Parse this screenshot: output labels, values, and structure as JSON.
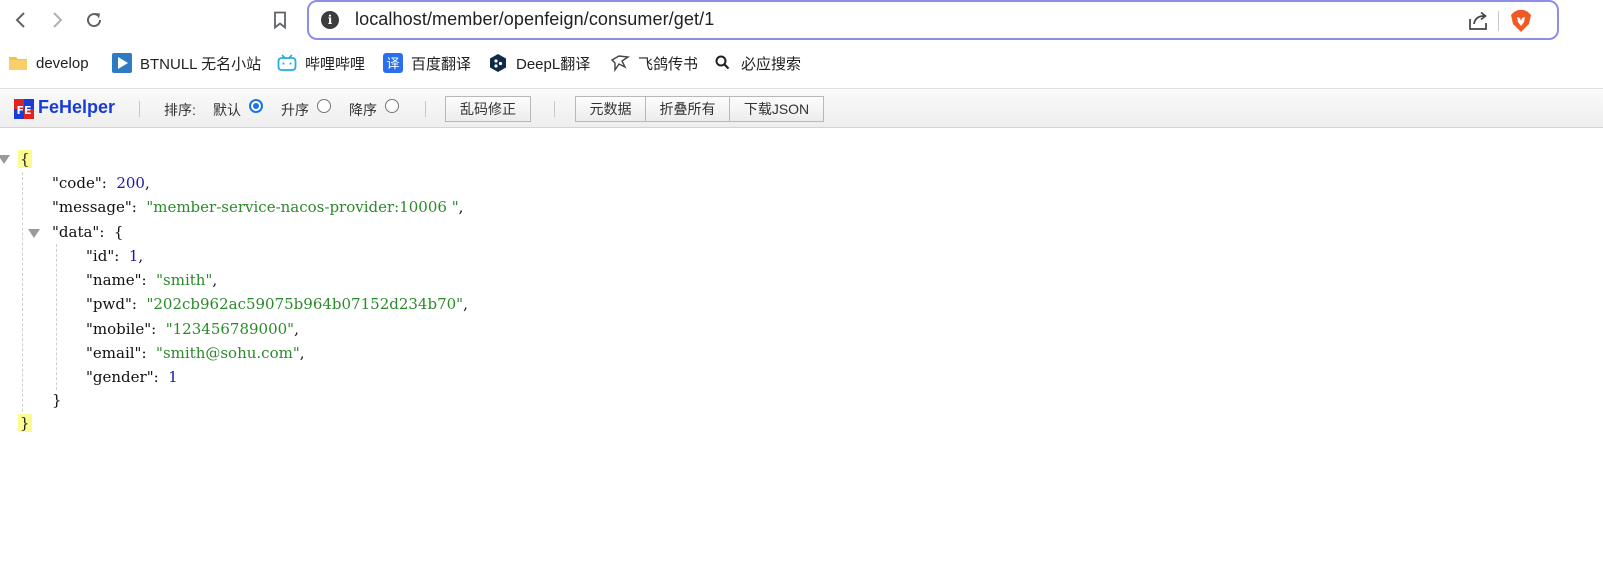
{
  "browser": {
    "url": "localhost/member/openfeign/consumer/get/1",
    "icons": {
      "back": "back-arrow-icon",
      "forward": "forward-arrow-icon",
      "reload": "reload-icon",
      "bookmark": "bookmark-icon",
      "info": "site-info-icon",
      "share": "share-icon",
      "brave": "brave-shield-icon"
    },
    "accent_color": "#8e8ee6"
  },
  "bookmarks": [
    {
      "label": "develop",
      "icon": "folder-icon"
    },
    {
      "label": "BTNULL 无名小站",
      "icon": "play-icon"
    },
    {
      "label": "哔哩哔哩",
      "icon": "bilibili-icon"
    },
    {
      "label": "百度翻译",
      "icon": "translate-icon"
    },
    {
      "label": "DeepL翻译",
      "icon": "deepl-icon"
    },
    {
      "label": "飞鸽传书",
      "icon": "pigeon-icon"
    },
    {
      "label": "必应搜索",
      "icon": "search-icon"
    }
  ],
  "fehelper": {
    "title": "FeHelper",
    "sort_label": "排序:",
    "sort_options": [
      {
        "label": "默认",
        "checked": true
      },
      {
        "label": "升序",
        "checked": false
      },
      {
        "label": "降序",
        "checked": false
      }
    ],
    "fix_encoding": "乱码修正",
    "metadata": "元数据",
    "collapse_all": "折叠所有",
    "download_json": "下载JSON",
    "brand_color": "#1a3cd6"
  },
  "json": {
    "code": {
      "key": "code",
      "value": "200"
    },
    "message": {
      "key": "message",
      "value": "member-service-nacos-provider:10006 "
    },
    "data_key": "data",
    "data": [
      {
        "key": "id",
        "value": "1",
        "type": "number"
      },
      {
        "key": "name",
        "value": "smith",
        "type": "string"
      },
      {
        "key": "pwd",
        "value": "202cb962ac59075b964b07152d234b70",
        "type": "string"
      },
      {
        "key": "mobile",
        "value": "123456789000",
        "type": "string"
      },
      {
        "key": "email",
        "value": "smith@sohu.com",
        "type": "string"
      },
      {
        "key": "gender",
        "value": "1",
        "type": "number"
      }
    ],
    "colors": {
      "number": "#1a1aa6",
      "string": "#2b8a2b",
      "highlight": "#fbfb92"
    }
  }
}
